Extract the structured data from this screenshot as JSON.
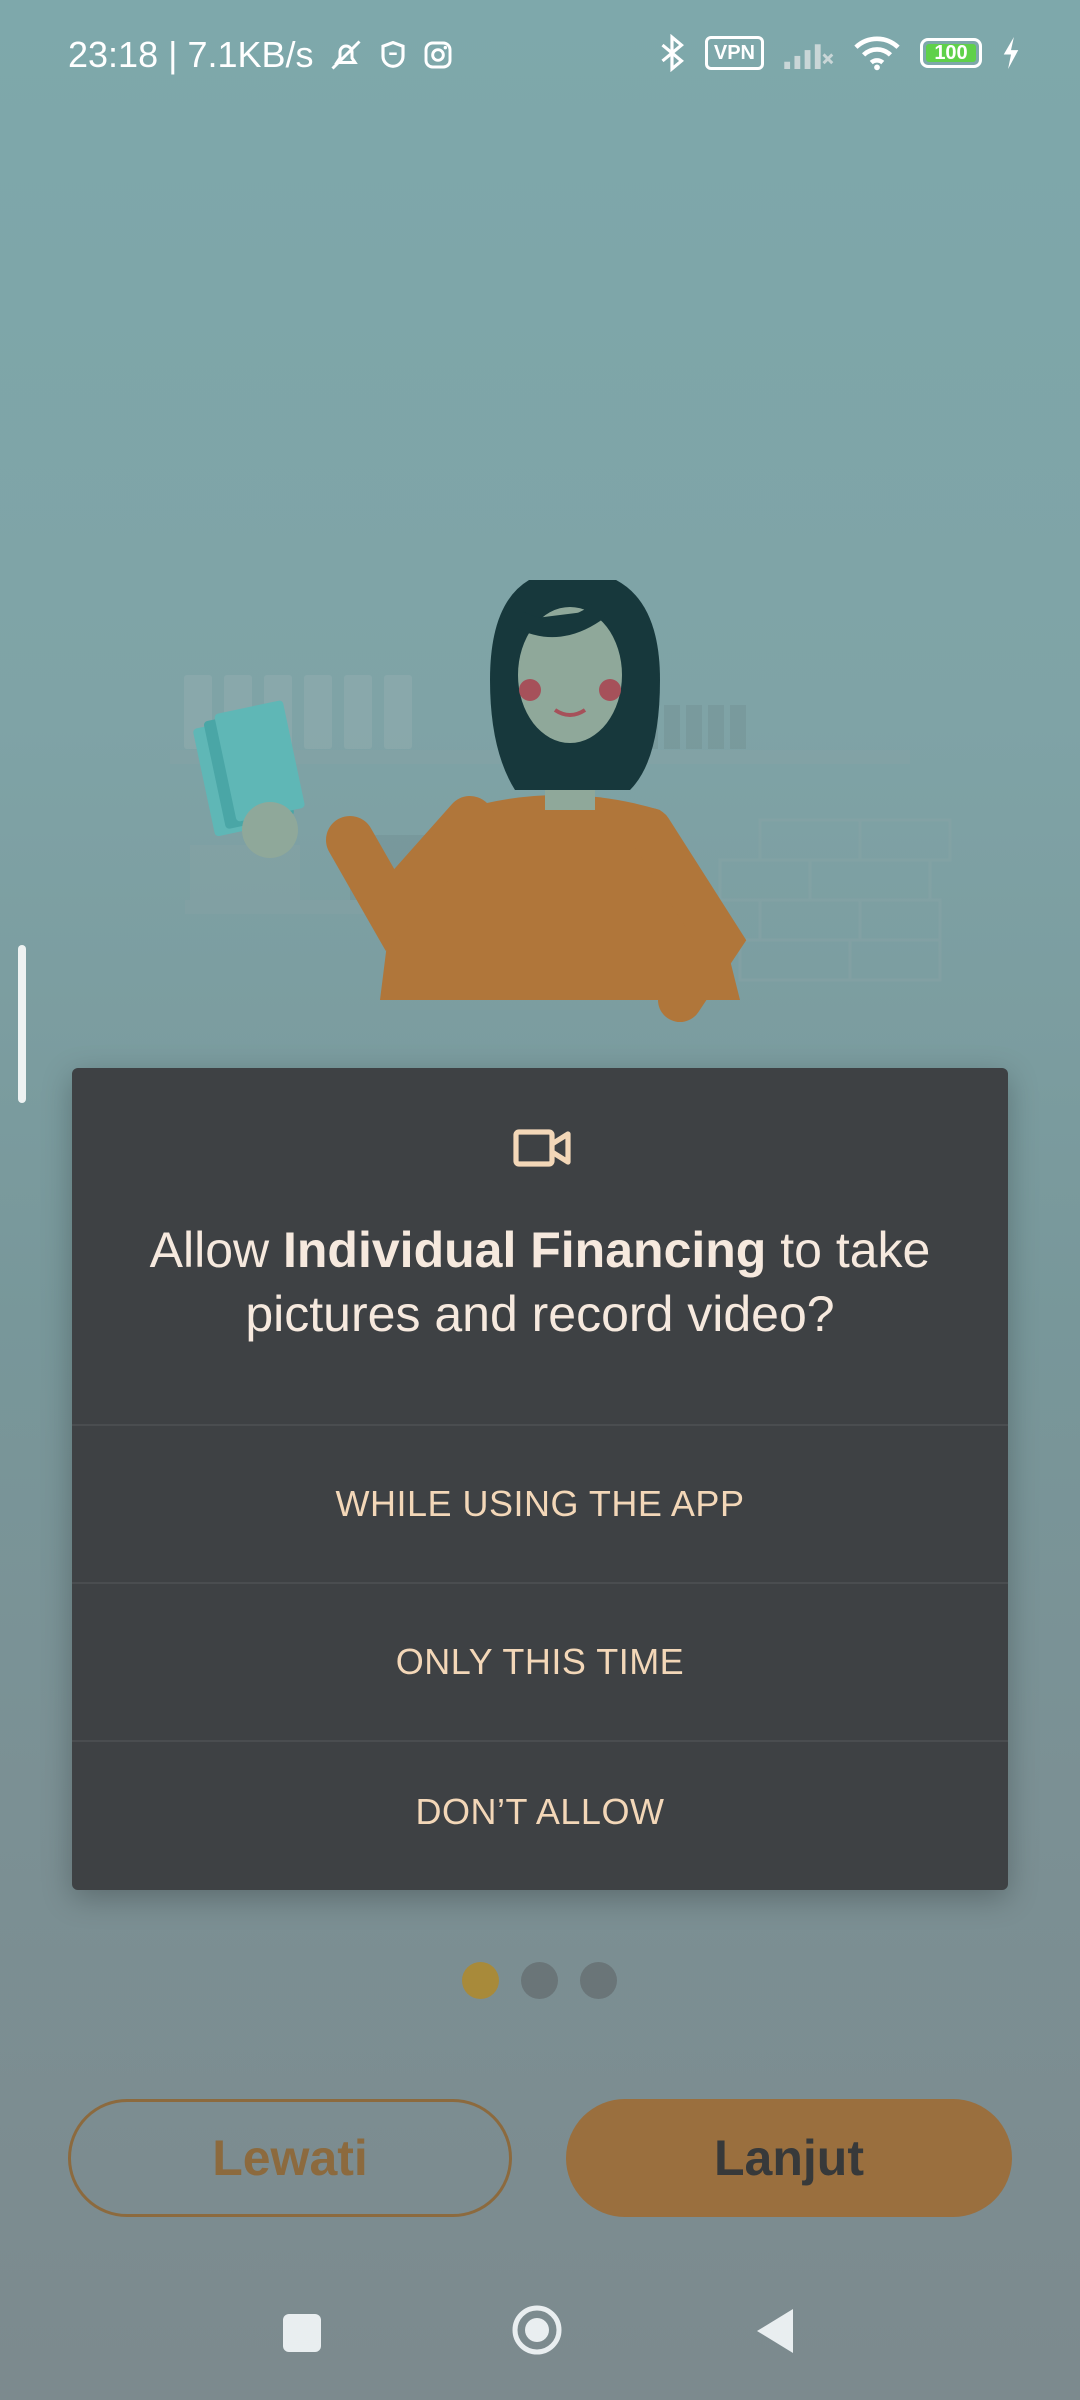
{
  "status_bar": {
    "time_speed": "23:18 | 7.1KB/s",
    "vpn": "VPN",
    "battery": "100",
    "icons": [
      "bell-off-icon",
      "shield-icon",
      "instagram-icon",
      "bluetooth-icon",
      "vpn-icon",
      "signal-icon",
      "wifi-icon",
      "battery-icon",
      "charging-icon"
    ]
  },
  "dialog": {
    "icon": "video-camera-icon",
    "title_prefix": "Allow ",
    "app_name": "Individual Financing",
    "title_suffix": " to take pictures and record video?",
    "buttons": [
      "WHILE USING THE APP",
      "ONLY THIS TIME",
      "DON’T ALLOW"
    ]
  },
  "pager": {
    "total": 3,
    "active_index": 0
  },
  "actions": {
    "skip": "Lewati",
    "next": "Lanjut"
  },
  "nav_bar": [
    "recents-icon",
    "home-icon",
    "back-icon"
  ],
  "colors": {
    "accent": "#9a6f3e",
    "dialog_bg": "#3e4144",
    "dialog_text": "#f3d7b8",
    "active_dot": "#a88a3a"
  }
}
